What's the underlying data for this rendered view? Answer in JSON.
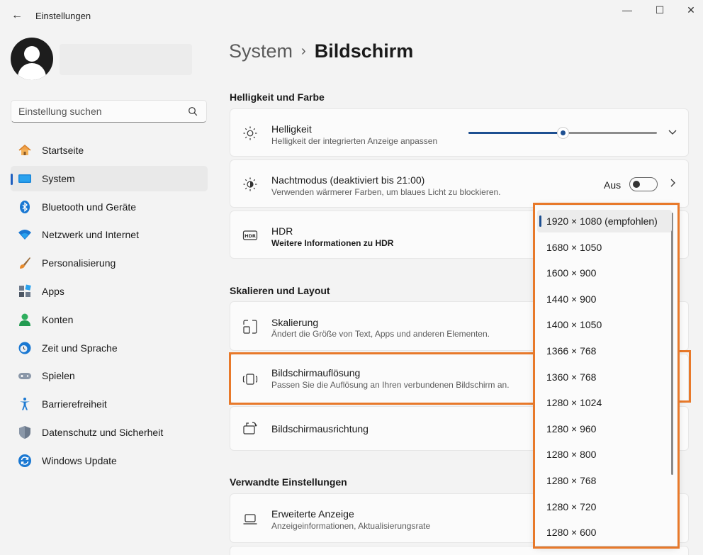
{
  "window": {
    "title": "Einstellungen",
    "back_icon": "←",
    "minimize_icon": "—",
    "maximize_icon": "☐",
    "close_icon": "✕"
  },
  "search": {
    "placeholder": "Einstellung suchen"
  },
  "sidebar": {
    "items": [
      {
        "label": "Startseite",
        "icon": "home-icon",
        "active": false
      },
      {
        "label": "System",
        "icon": "system-icon",
        "active": true
      },
      {
        "label": "Bluetooth und Geräte",
        "icon": "bluetooth-icon",
        "active": false
      },
      {
        "label": "Netzwerk und Internet",
        "icon": "wifi-icon",
        "active": false
      },
      {
        "label": "Personalisierung",
        "icon": "brush-icon",
        "active": false
      },
      {
        "label": "Apps",
        "icon": "apps-icon",
        "active": false
      },
      {
        "label": "Konten",
        "icon": "account-icon",
        "active": false
      },
      {
        "label": "Zeit und Sprache",
        "icon": "clock-globe-icon",
        "active": false
      },
      {
        "label": "Spielen",
        "icon": "gamepad-icon",
        "active": false
      },
      {
        "label": "Barrierefreiheit",
        "icon": "accessibility-icon",
        "active": false
      },
      {
        "label": "Datenschutz und Sicherheit",
        "icon": "shield-icon",
        "active": false
      },
      {
        "label": "Windows Update",
        "icon": "update-icon",
        "active": false
      }
    ]
  },
  "breadcrumb": {
    "parent": "System",
    "separator": "›",
    "current": "Bildschirm"
  },
  "sections": {
    "brightness_color": "Helligkeit und Farbe",
    "scale_layout": "Skalieren und Layout",
    "related": "Verwandte Einstellungen"
  },
  "cards": {
    "brightness": {
      "title": "Helligkeit",
      "subtitle": "Helligkeit der integrierten Anzeige anpassen",
      "value_percent": 50
    },
    "night": {
      "title": "Nachtmodus (deaktiviert bis 21:00)",
      "subtitle": "Verwenden wärmerer Farben, um blaues Licht zu blockieren.",
      "toggle_label": "Aus",
      "toggle_on": false
    },
    "hdr": {
      "title": "HDR",
      "link": "Weitere Informationen zu HDR",
      "icon_text": "HDR"
    },
    "scaling": {
      "title": "Skalierung",
      "subtitle": "Ändert die Größe von Text, Apps und anderen Elementen."
    },
    "resolution": {
      "title": "Bildschirmauflösung",
      "subtitle": "Passen Sie die Auflösung an Ihren verbundenen Bildschirm an."
    },
    "orientation": {
      "title": "Bildschirmausrichtung"
    },
    "advanced": {
      "title": "Erweiterte Anzeige",
      "subtitle": "Anzeigeinformationen, Aktualisierungsrate"
    }
  },
  "resolution_dropdown": {
    "selected_index": 0,
    "options": [
      "1920 × 1080 (empfohlen)",
      "1680 × 1050",
      "1600 × 900",
      "1440 × 900",
      "1400 × 1050",
      "1366 × 768",
      "1360 × 768",
      "1280 × 1024",
      "1280 × 960",
      "1280 × 800",
      "1280 × 768",
      "1280 × 720",
      "1280 × 600"
    ]
  },
  "colors": {
    "accent": "#1d4f91",
    "highlight": "#e8792a"
  }
}
